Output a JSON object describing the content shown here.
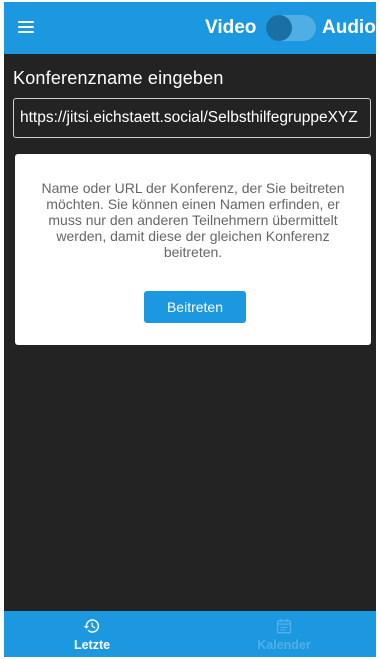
{
  "header": {
    "video_label": "Video",
    "audio_label": "Audio",
    "audio_only_enabled": false
  },
  "conference": {
    "title": "Konferenzname eingeben",
    "url_value": "https://jitsi.eichstaett.social/SelbsthilfegruppeXYZ",
    "help_text": "Name oder URL der Konferenz, der Sie beitreten möchten. Sie können einen Namen erfinden, er muss nur den anderen Teilnehmern übermittelt werden, damit diese der gleichen Konferenz beitreten.",
    "join_label": "Beitreten"
  },
  "bottom_nav": {
    "items": [
      {
        "label": "Letzte",
        "icon": "history-icon",
        "active": true
      },
      {
        "label": "Kalender",
        "icon": "calendar-icon",
        "active": false
      }
    ]
  },
  "colors": {
    "accent": "#1b98e0",
    "background": "#232323",
    "inactive_nav": "#52aee8"
  }
}
